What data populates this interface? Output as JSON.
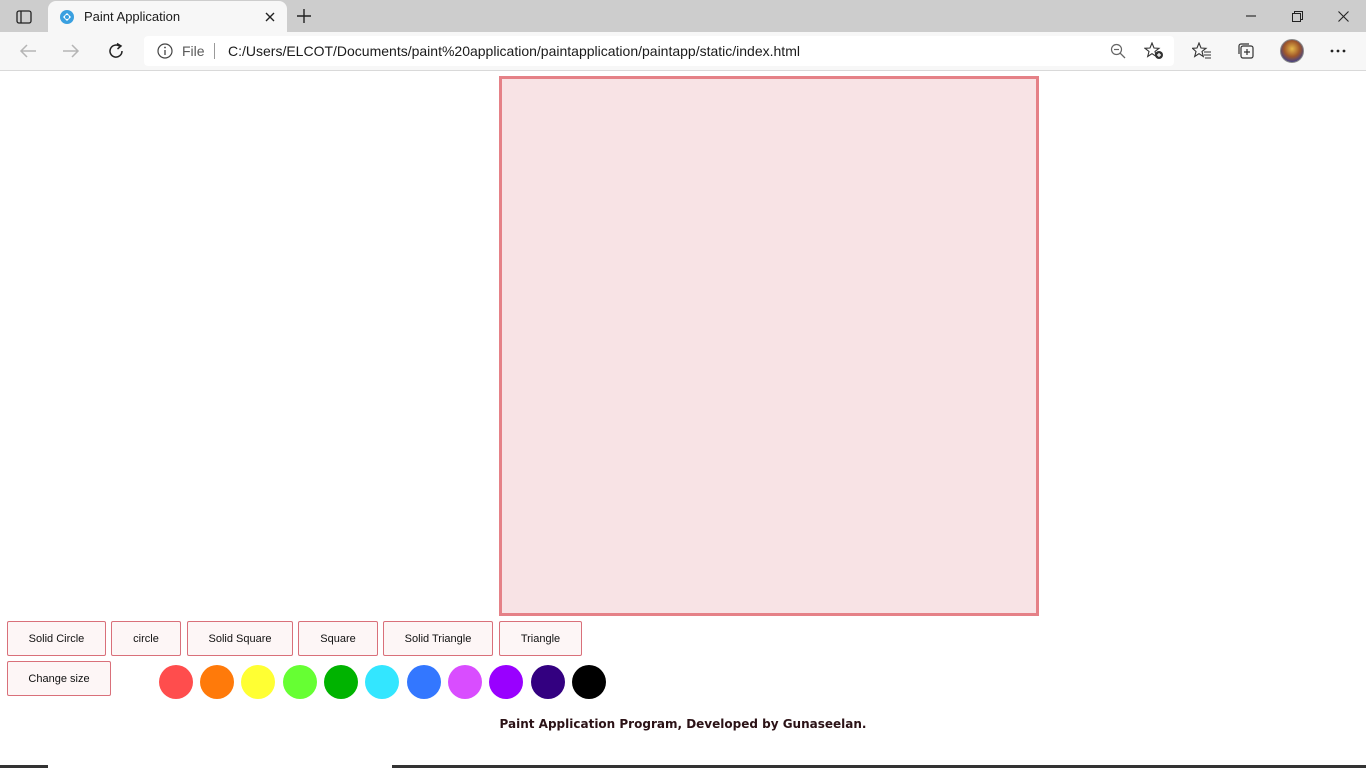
{
  "browser": {
    "tab_title": "Paint Application",
    "address_scheme_label": "File",
    "url": "C:/Users/ELCOT/Documents/paint%20application/paintapplication/paintapp/static/index.html"
  },
  "toolbar_buttons": {
    "solid_circle": "Solid Circle",
    "circle": "circle",
    "solid_square": "Solid Square",
    "square": "Square",
    "solid_triangle": "Solid Triangle",
    "triangle": "Triangle",
    "change_size": "Change size"
  },
  "palette": [
    "#ff4d4d",
    "#ff7a0a",
    "#ffff33",
    "#66ff33",
    "#00b300",
    "#33e6ff",
    "#3377ff",
    "#d94dff",
    "#9900ff",
    "#330080",
    "#000000"
  ],
  "canvas": {
    "background": "#f8e3e5",
    "border": "#e58187"
  },
  "footer": "Paint Application Program, Developed by Gunaseelan."
}
